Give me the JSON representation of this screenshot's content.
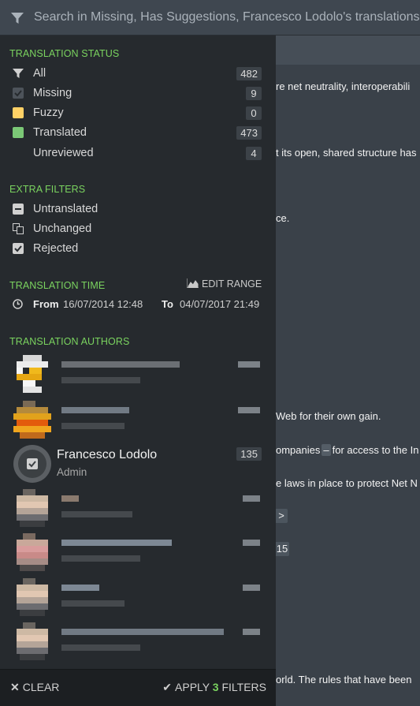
{
  "search": {
    "placeholder": "Search in Missing, Has Suggestions, Francesco Lodolo's translations"
  },
  "background_text": {
    "line1": "re net neutrality, interoperabili",
    "line2": "t its open, shared structure has",
    "line3": "ce.",
    "line4": "Web for their own gain.",
    "line5a": "ompanies",
    "line5b": "–",
    "line5c": "for access to the In",
    "line6": "e laws in place to protect Net N",
    "badge1": ">",
    "badge2": "15",
    "line7": "orld. The rules that have been"
  },
  "status": {
    "title": "TRANSLATION STATUS",
    "items": [
      {
        "label": "All",
        "count": "482",
        "icon": "filter-icon"
      },
      {
        "label": "Missing",
        "count": "9",
        "icon": "missing-icon"
      },
      {
        "label": "Fuzzy",
        "count": "0",
        "icon": "fuzzy-icon"
      },
      {
        "label": "Translated",
        "count": "473",
        "icon": "translated-icon"
      },
      {
        "label": "Unreviewed",
        "count": "4",
        "icon": "unreviewed-icon"
      }
    ]
  },
  "extra": {
    "title": "EXTRA FILTERS",
    "items": [
      {
        "label": "Untranslated",
        "icon": "untranslated-icon"
      },
      {
        "label": "Unchanged",
        "icon": "unchanged-icon"
      },
      {
        "label": "Rejected",
        "icon": "rejected-icon"
      }
    ]
  },
  "time": {
    "title": "TRANSLATION TIME",
    "edit_range": "EDIT RANGE",
    "from_label": "From",
    "from_value": "16/07/2014 12:48",
    "to_label": "To",
    "to_value": "04/07/2017 21:49"
  },
  "authors": {
    "title": "TRANSLATION AUTHORS",
    "featured": {
      "name": "Francesco Lodolo",
      "role": "Admin",
      "count": "135"
    }
  },
  "footer": {
    "clear": "CLEAR",
    "apply_prefix": "APPLY",
    "apply_count": "3",
    "apply_suffix": "FILTERS"
  },
  "colors": {
    "accent": "#7ad35f",
    "fuzzy": "#ffd166",
    "translated": "#7bc876",
    "panel_bg": "#262a2e"
  }
}
